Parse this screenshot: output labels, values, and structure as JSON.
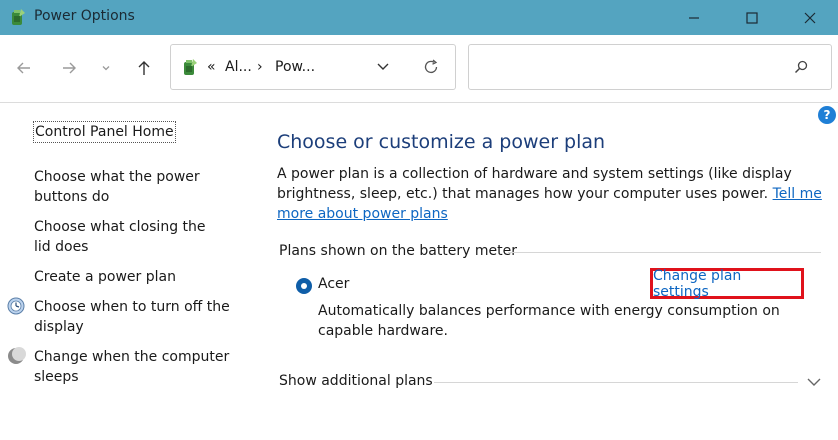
{
  "window": {
    "title": "Power Options"
  },
  "address": {
    "overflow": "«",
    "crumb1": "Al...",
    "sep": "›",
    "crumb2": "Pow..."
  },
  "sidebar": {
    "home_link": "Control Panel Home",
    "links": [
      "Choose what the power buttons do",
      "Choose what closing the lid does",
      "Create a power plan",
      "Choose when to turn off the display",
      "Change when the computer sleeps"
    ]
  },
  "main": {
    "title": "Choose or customize a power plan",
    "description": "A power plan is a collection of hardware and system settings (like display brightness, sleep, etc.) that manages how your computer uses power.",
    "description_link": "Tell me more about power plans",
    "plans_section_label": "Plans shown on the battery meter",
    "plan": {
      "name": "Acer",
      "selected": true,
      "description": "Automatically balances performance with energy consumption on capable hardware.",
      "change_link": "Change plan settings"
    },
    "additional_plans_label": "Show additional plans"
  },
  "help": {
    "label": "?"
  },
  "colors": {
    "titlebar": "#54a4c0",
    "link": "#0d66c2",
    "heading": "#1c3e7a",
    "highlight_box": "#e0121b",
    "radio": "#0f5ea8"
  },
  "icons": [
    "power-options-icon",
    "minimize-icon",
    "maximize-icon",
    "close-icon",
    "back-arrow-icon",
    "forward-arrow-icon",
    "recent-chevron-icon",
    "up-arrow-icon",
    "refresh-icon",
    "search-icon",
    "display-off-icon",
    "sleep-moon-icon",
    "expand-chevron-icon"
  ]
}
